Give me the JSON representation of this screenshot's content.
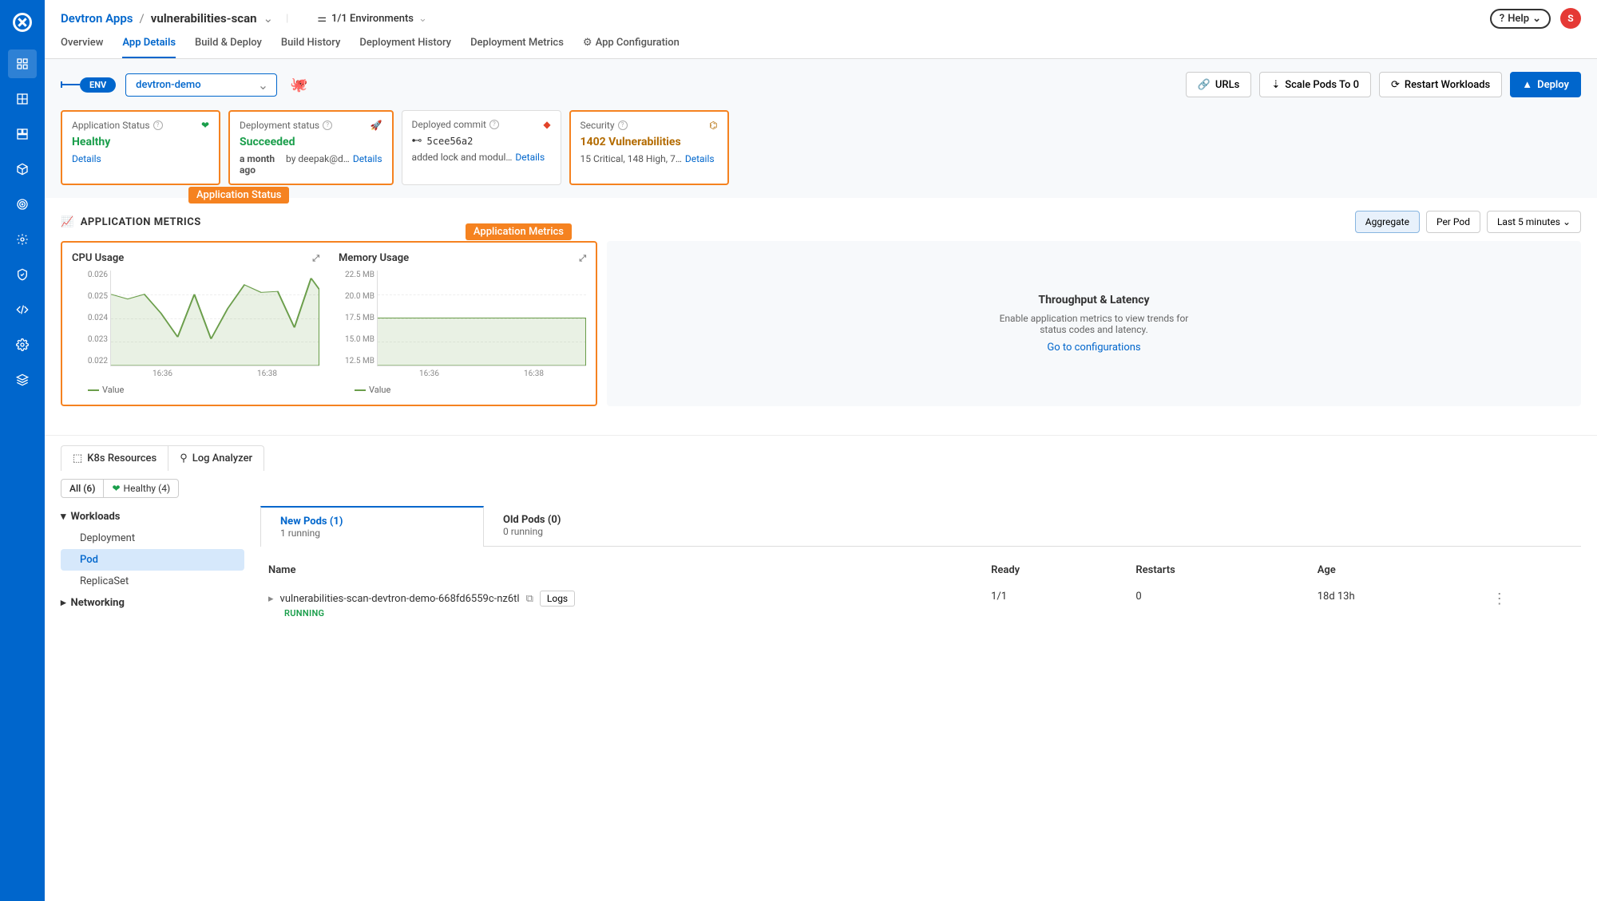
{
  "breadcrumb": {
    "root": "Devtron Apps",
    "current": "vulnerabilities-scan"
  },
  "envFilter": "1/1 Environments",
  "help": "Help",
  "avatar": "S",
  "tabs": [
    "Overview",
    "App Details",
    "Build & Deploy",
    "Build History",
    "Deployment History",
    "Deployment Metrics",
    "App Configuration"
  ],
  "envBadge": "ENV",
  "envSelected": "devtron-demo",
  "actionButtons": {
    "urls": "URLs",
    "scale": "Scale Pods To 0",
    "restart": "Restart Workloads",
    "deploy": "Deploy"
  },
  "cards": {
    "appStatus": {
      "label": "Application Status",
      "value": "Healthy",
      "details": "Details"
    },
    "deployStatus": {
      "label": "Deployment status",
      "value": "Succeeded",
      "time": "a month ago",
      "by": "by deepak@devtr…",
      "details": "Details"
    },
    "commit": {
      "label": "Deployed commit",
      "hash": "5cee56a2",
      "msg": "added lock and modul…",
      "details": "Details"
    },
    "security": {
      "label": "Security",
      "value": "1402 Vulnerabilities",
      "summary": "15 Critical, 148 High, 7…",
      "details": "Details"
    }
  },
  "callouts": {
    "status": "Application Status",
    "metrics": "Application Metrics"
  },
  "metrics": {
    "title": "APPLICATION METRICS",
    "toggles": {
      "aggregate": "Aggregate",
      "perpod": "Per Pod",
      "range": "Last 5 minutes"
    },
    "cpu": {
      "title": "CPU Usage",
      "legend": "Value"
    },
    "mem": {
      "title": "Memory Usage",
      "legend": "Value"
    },
    "tl": {
      "title": "Throughput & Latency",
      "desc": "Enable application metrics to view trends for status codes and latency.",
      "link": "Go to configurations"
    }
  },
  "chart_data": [
    {
      "type": "line",
      "title": "CPU Usage",
      "x": [
        "16:36",
        "16:38"
      ],
      "ylim": [
        0.022,
        0.026
      ],
      "yticks": [
        0.022,
        0.023,
        0.024,
        0.025,
        0.026
      ],
      "series": [
        {
          "name": "Value",
          "values": [
            0.025,
            0.0245,
            0.025,
            0.024,
            0.023,
            0.025,
            0.023,
            0.0245,
            0.0255,
            0.025,
            0.0235,
            0.026
          ]
        }
      ]
    },
    {
      "type": "line",
      "title": "Memory Usage",
      "x": [
        "16:36",
        "16:38"
      ],
      "ylim": [
        12.5,
        22.5
      ],
      "yticks": [
        "12.5 MB",
        "15.0 MB",
        "17.5 MB",
        "20.0 MB",
        "22.5 MB"
      ],
      "series": [
        {
          "name": "Value",
          "values": [
            17.5,
            17.5,
            17.5,
            17.5,
            17.5,
            17.5,
            17.5,
            17.5,
            17.5,
            17.5,
            17.5,
            17.5
          ]
        }
      ]
    }
  ],
  "resTabs": {
    "k8s": "K8s Resources",
    "log": "Log Analyzer"
  },
  "chips": {
    "all": "All (6)",
    "healthy": "Healthy (4)"
  },
  "tree": {
    "workloads": "Workloads",
    "items": [
      "Deployment",
      "Pod",
      "ReplicaSet"
    ],
    "networking": "Networking"
  },
  "podTabs": {
    "new": {
      "title": "New Pods (1)",
      "sub": "1 running"
    },
    "old": {
      "title": "Old Pods (0)",
      "sub": "0 running"
    }
  },
  "podTable": {
    "cols": {
      "name": "Name",
      "ready": "Ready",
      "restarts": "Restarts",
      "age": "Age"
    },
    "row": {
      "name": "vulnerabilities-scan-devtron-demo-668fd6559c-nz6tl",
      "status": "RUNNING",
      "logs": "Logs",
      "ready": "1/1",
      "restarts": "0",
      "age": "18d 13h"
    }
  }
}
